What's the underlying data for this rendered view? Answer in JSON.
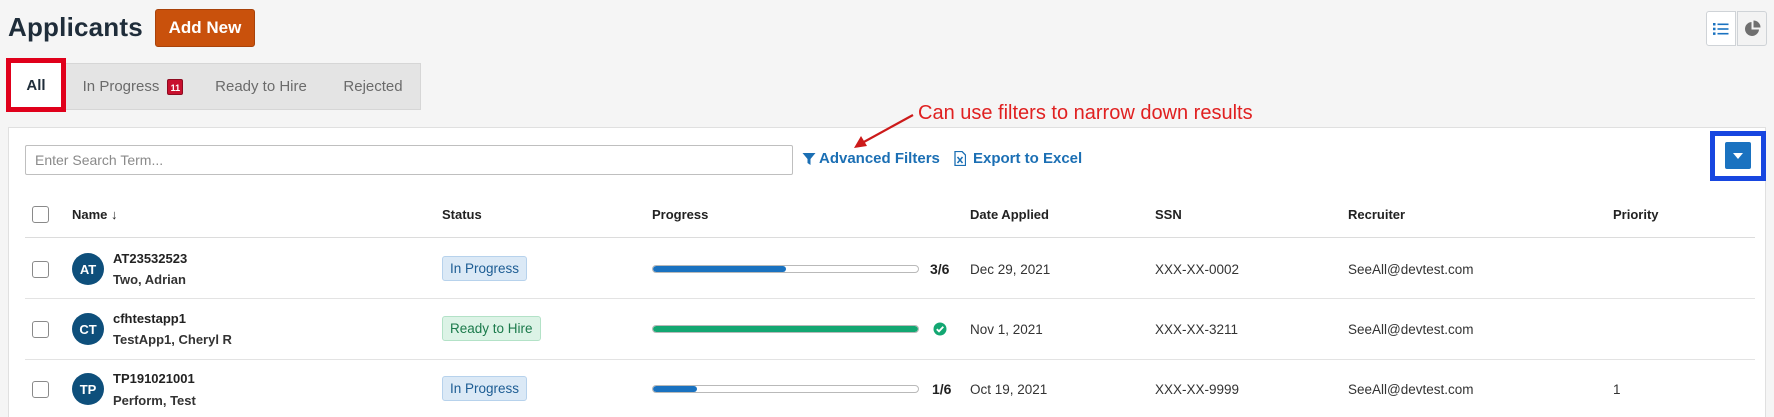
{
  "header": {
    "title": "Applicants",
    "add_new_label": "Add New"
  },
  "tabs": [
    {
      "label": "All",
      "active": true
    },
    {
      "label": "In Progress",
      "badge": "11"
    },
    {
      "label": "Ready to Hire"
    },
    {
      "label": "Rejected"
    }
  ],
  "toolbar": {
    "search_placeholder": "Enter Search Term...",
    "advanced_filters_label": "Advanced Filters",
    "export_label": "Export to Excel"
  },
  "annotation": {
    "text": "Can use filters to narrow down results"
  },
  "table": {
    "columns": [
      "Name",
      "Status",
      "Progress",
      "Date Applied",
      "SSN",
      "Recruiter",
      "Priority"
    ],
    "sort_indicator": "↓",
    "rows": [
      {
        "initials": "AT",
        "id": "AT23532523",
        "name": "Two, Adrian",
        "status": "In Progress",
        "progress_text": "3/6",
        "progress": 0.5,
        "date": "Dec 29, 2021",
        "ssn": "XXX-XX-0002",
        "recruiter": "SeeAll@devtest.com",
        "priority": ""
      },
      {
        "initials": "CT",
        "id": "cfhtestapp1",
        "name": "TestApp1, Cheryl R",
        "status": "Ready to Hire",
        "progress_text": "",
        "progress": 1.0,
        "date": "Nov 1, 2021",
        "ssn": "XXX-XX-3211",
        "recruiter": "SeeAll@devtest.com",
        "priority": ""
      },
      {
        "initials": "TP",
        "id": "TP191021001",
        "name": "Perform, Test",
        "status": "In Progress",
        "progress_text": "1/6",
        "progress": 0.1667,
        "date": "Oct 19, 2021",
        "ssn": "XXX-XX-9999",
        "recruiter": "SeeAll@devtest.com",
        "priority": "1"
      }
    ]
  },
  "colors": {
    "accent_orange": "#c9510c",
    "link_blue": "#1b6fb4",
    "progress_blue": "#1a72c0",
    "progress_green": "#13a772",
    "highlight_red": "#e0001b",
    "highlight_blue": "#1746e0"
  },
  "icons": [
    "list-view-icon",
    "pie-chart-icon",
    "filter-icon",
    "excel-icon",
    "caret-down-icon",
    "check-circle-icon"
  ]
}
